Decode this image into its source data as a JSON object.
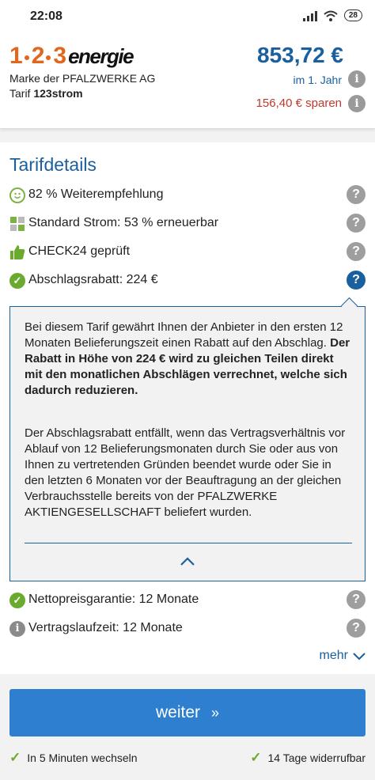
{
  "status": {
    "time": "22:08",
    "battery": "28"
  },
  "header": {
    "logo_digits": [
      "1",
      "2",
      "3"
    ],
    "logo_word": "energie",
    "brand": "Marke der PFALZWERKE AG",
    "tarif_prefix": "Tarif",
    "tarif_name": "123strom",
    "price": "853,72 €",
    "period": "im 1. Jahr",
    "savings": "156,40 € sparen"
  },
  "details": {
    "title": "Tarifdetails",
    "items": [
      {
        "label": "82 % Weiterempfehlung",
        "icon": "smiley-icon"
      },
      {
        "label": "Standard Strom: 53 % erneuerbar",
        "icon": "leaf-icon"
      },
      {
        "label": "CHECK24 geprüft",
        "icon": "thumbs-up-icon"
      },
      {
        "label": "Abschlagsrabatt: 224 €",
        "icon": "check-circle-icon"
      },
      {
        "label": "Nettopreisgarantie: 12 Monate",
        "icon": "check-circle-icon"
      },
      {
        "label": "Vertragslaufzeit: 12 Monate",
        "icon": "info-icon"
      }
    ],
    "tooltip": {
      "para1_normal": "Bei diesem Tarif gewährt Ihnen der Anbieter in den ersten 12 Monaten Belieferungszeit einen Rabatt auf den Abschlag. ",
      "para1_bold": "Der Rabatt in Höhe von 224 € wird zu gleichen Teilen direkt mit den monatlichen Abschlägen verrechnet, welche sich dadurch reduzieren.",
      "para2": "Der Abschlagsrabatt entfällt, wenn das Vertragsverhältnis vor Ablauf von 12 Belieferungsmonaten durch Sie oder aus von Ihnen zu vertretenden Gründen beendet wurde oder Sie in den letzten 6 Monaten vor der Beauftragung an der gleichen Verbrauchsstelle bereits von der PFALZWERKE AKTIENGESELLSCHAFT beliefert wurden."
    },
    "more_label": "mehr"
  },
  "cta": {
    "label": "weiter",
    "chevron": "»"
  },
  "footer": {
    "left": "In 5 Minuten wechseln",
    "right": "14 Tage widerrufbar"
  },
  "colors": {
    "primary": "#1a5f9e",
    "button": "#2e7fd0",
    "savings": "#c0392b",
    "logo": "#e2661b",
    "check": "#6aaa2e"
  }
}
